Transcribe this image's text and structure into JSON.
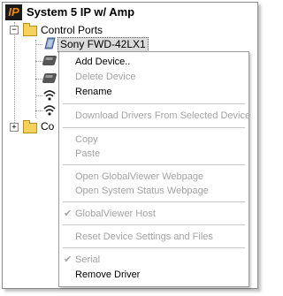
{
  "tree": {
    "title": "System 5 IP w/ Amp",
    "logo_text": "IP",
    "control_ports": {
      "expander": "−",
      "label": "Control Ports"
    },
    "selected_device": "Sony FWD-42LX1",
    "collapsed_folder": {
      "expander": "+",
      "label": "Co"
    }
  },
  "icons": {
    "logo": "ip-logo-icon",
    "folder": "folder-icon",
    "display_device": "display-device-icon",
    "device": "device-icon",
    "wireless": "wireless-icon"
  },
  "context_menu": {
    "items": [
      {
        "label": "Add Device..",
        "enabled": true
      },
      {
        "label": "Delete Device",
        "enabled": false
      },
      {
        "label": "Rename",
        "enabled": true
      },
      {
        "label": "Download Drivers From Selected Device",
        "enabled": false
      },
      {
        "label": "Copy",
        "enabled": false
      },
      {
        "label": "Paste",
        "enabled": false
      },
      {
        "label": "Open GlobalViewer Webpage",
        "enabled": false
      },
      {
        "label": "Open System Status Webpage",
        "enabled": false
      },
      {
        "label": "GlobalViewer Host",
        "enabled": false,
        "checked": true
      },
      {
        "label": "Reset Device Settings and Files",
        "enabled": false
      },
      {
        "label": "Serial",
        "enabled": false,
        "checked": true
      },
      {
        "label": "Remove Driver",
        "enabled": true
      }
    ],
    "check_glyph": "✔"
  }
}
